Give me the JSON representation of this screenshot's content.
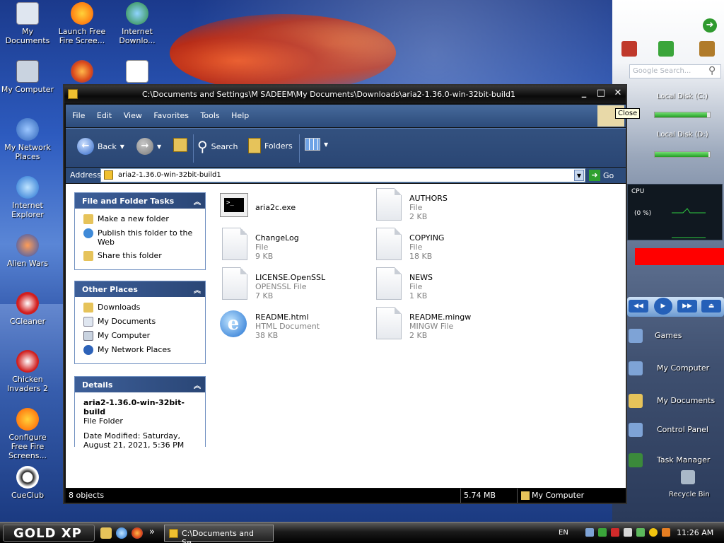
{
  "desktop": {
    "icons": [
      {
        "label": "My Documents"
      },
      {
        "label": "Launch Free Fire Scree..."
      },
      {
        "label": "Internet Downlo..."
      },
      {
        "label": "My Computer"
      },
      {
        "label": "My Network Places"
      },
      {
        "label": "Internet Explorer"
      },
      {
        "label": "Alien Wars"
      },
      {
        "label": "CCleaner"
      },
      {
        "label": "Chicken Invaders 2"
      },
      {
        "label": "Configure Free Fire Screens..."
      },
      {
        "label": "CueClub"
      }
    ]
  },
  "sidebar": {
    "search_placeholder": "Google Search...",
    "disks": [
      {
        "label": "Local Disk (C:)",
        "fill": 0.95
      },
      {
        "label": "Local Disk (D:)",
        "fill": 0.98
      }
    ],
    "cpu_label": "CPU",
    "cpu_percent": "(0 %)",
    "links": [
      {
        "label": "Games"
      },
      {
        "label": "My Computer"
      },
      {
        "label": "My Documents"
      },
      {
        "label": "Control Panel"
      },
      {
        "label": "Task Manager"
      },
      {
        "label": "Recycle Bin"
      }
    ]
  },
  "window": {
    "title": "C:\\Documents and Settings\\M SADEEM\\My Documents\\Downloads\\aria2-1.36.0-win-32bit-build1",
    "tooltip": "Close",
    "menu": [
      "File",
      "Edit",
      "View",
      "Favorites",
      "Tools",
      "Help"
    ],
    "toolbar": {
      "back": "Back",
      "search": "Search",
      "folders": "Folders"
    },
    "address": {
      "label": "Address",
      "value": "aria2-1.36.0-win-32bit-build1",
      "go": "Go"
    },
    "tasks_panel": {
      "title": "File and Folder Tasks",
      "items": [
        "Make a new folder",
        "Publish this folder to the Web",
        "Share this folder"
      ]
    },
    "places_panel": {
      "title": "Other Places",
      "items": [
        "Downloads",
        "My Documents",
        "My Computer",
        "My Network Places"
      ]
    },
    "details_panel": {
      "title": "Details",
      "name": "aria2-1.36.0-win-32bit-build",
      "type": "File Folder",
      "modified": "Date Modified: Saturday, August 21, 2021, 5:36 PM"
    },
    "files": [
      {
        "name": "aria2c.exe",
        "type": "",
        "size": ""
      },
      {
        "name": "AUTHORS",
        "type": "File",
        "size": "2 KB"
      },
      {
        "name": "ChangeLog",
        "type": "File",
        "size": "9 KB"
      },
      {
        "name": "COPYING",
        "type": "File",
        "size": "18 KB"
      },
      {
        "name": "LICENSE.OpenSSL",
        "type": "OPENSSL File",
        "size": "7 KB"
      },
      {
        "name": "NEWS",
        "type": "File",
        "size": "1 KB"
      },
      {
        "name": "README.html",
        "type": "HTML Document",
        "size": "38 KB"
      },
      {
        "name": "README.mingw",
        "type": "MINGW File",
        "size": "2 KB"
      }
    ],
    "status": {
      "objects": "8 objects",
      "size": "5.74 MB",
      "location": "My Computer"
    }
  },
  "taskbar": {
    "start_label": "GOLD XP",
    "task_title": "C:\\Documents and Se...",
    "language": "EN",
    "clock": "11:26 AM",
    "quicklaunch_more": "»"
  }
}
